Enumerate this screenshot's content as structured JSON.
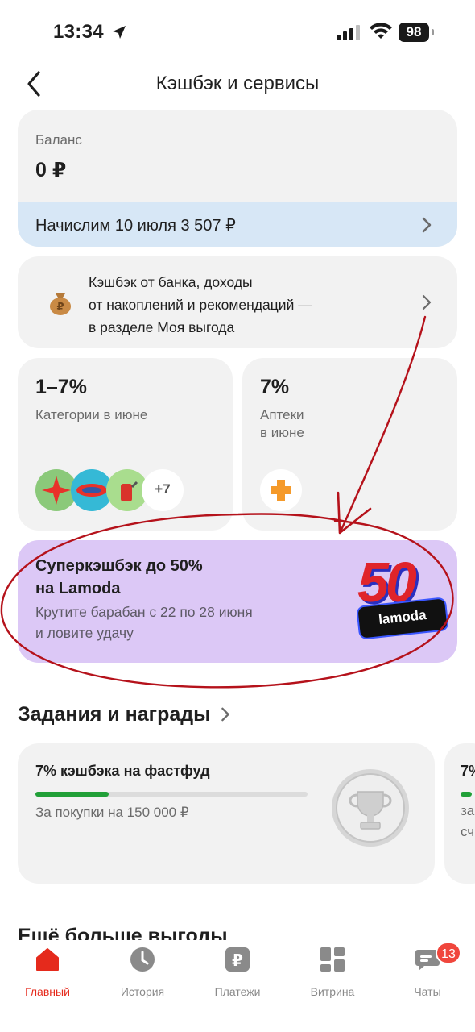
{
  "status_bar": {
    "time": "13:34",
    "battery": "98"
  },
  "nav": {
    "title": "Кэшбэк и сервисы"
  },
  "balance": {
    "label": "Баланс",
    "value": "0 ₽",
    "accrual_text": "Начислим 10 июля 3 507 ₽"
  },
  "info_card": {
    "lines": [
      "Кэшбэк от банка, доходы",
      "от накоплений и рекомендаций —",
      "в разделе Моя выгода"
    ]
  },
  "categories_card": {
    "percent": "1–7%",
    "label": "Категории в июне",
    "more_count": "+7"
  },
  "pharmacy_card": {
    "percent": "7%",
    "label_lines": [
      "Аптеки",
      "в июне"
    ]
  },
  "promo": {
    "title_lines": [
      "Суперкэшбэк до 50%",
      "на Lamoda"
    ],
    "sub_lines": [
      "Крутите барабан с 22 по 28 июня",
      "и ловите удачу"
    ],
    "badge_number": "50",
    "badge_brand": "lamoda"
  },
  "tasks": {
    "section_title": "Задания и награды",
    "items": [
      {
        "title": "7% кэшбэка на фастфуд",
        "subtitle": "За покупки на 150 000 ₽",
        "progress": 0.27
      }
    ],
    "peek_fragments": [
      "7%",
      "за",
      "сч"
    ]
  },
  "more_section": {
    "title": "Ещё больше выгоды"
  },
  "tabbar": {
    "items": [
      {
        "label": "Главный",
        "icon": "home-icon",
        "active": true
      },
      {
        "label": "История",
        "icon": "clock-icon",
        "active": false
      },
      {
        "label": "Платежи",
        "icon": "ruble-icon",
        "active": false
      },
      {
        "label": "Витрина",
        "icon": "grid-icon",
        "active": false
      },
      {
        "label": "Чаты",
        "icon": "chat-icon",
        "active": false
      }
    ],
    "chat_badge": "13"
  },
  "colors": {
    "accent_red": "#e52a1c",
    "annotation_red": "#b5121b",
    "promo_bg": "#dcc8f6",
    "accrual_bg": "#d7e7f6",
    "progress_green": "#21a038"
  }
}
